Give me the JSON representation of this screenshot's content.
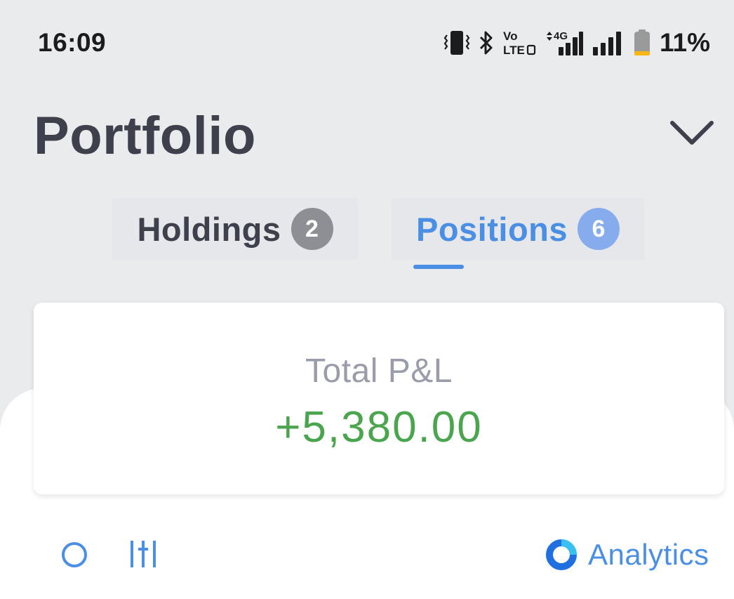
{
  "status_bar": {
    "time": "16:09",
    "battery_percent": "11%",
    "network": "4G",
    "volte": [
      "Vo",
      "LTE"
    ],
    "icons": [
      "vibrate-icon",
      "bluetooth-icon",
      "volte-icon",
      "signal-4g-icon",
      "signal-icon",
      "battery-icon"
    ]
  },
  "header": {
    "title": "Portfolio",
    "dropdown_icon": "chevron-down-icon"
  },
  "tabs": [
    {
      "label": "Holdings",
      "count": "2",
      "active": false
    },
    {
      "label": "Positions",
      "count": "6",
      "active": true
    }
  ],
  "pnl_card": {
    "label": "Total P&L",
    "value": "+5,380.00",
    "value_color": "#4ba54f"
  },
  "toolbar": {
    "search_icon": "search-icon",
    "filter_icon": "filter-icon",
    "analytics_label": "Analytics"
  },
  "colors": {
    "accent": "#4a8fe4",
    "profit": "#4ba54f",
    "background": "#eaebed",
    "card": "#ffffff"
  }
}
